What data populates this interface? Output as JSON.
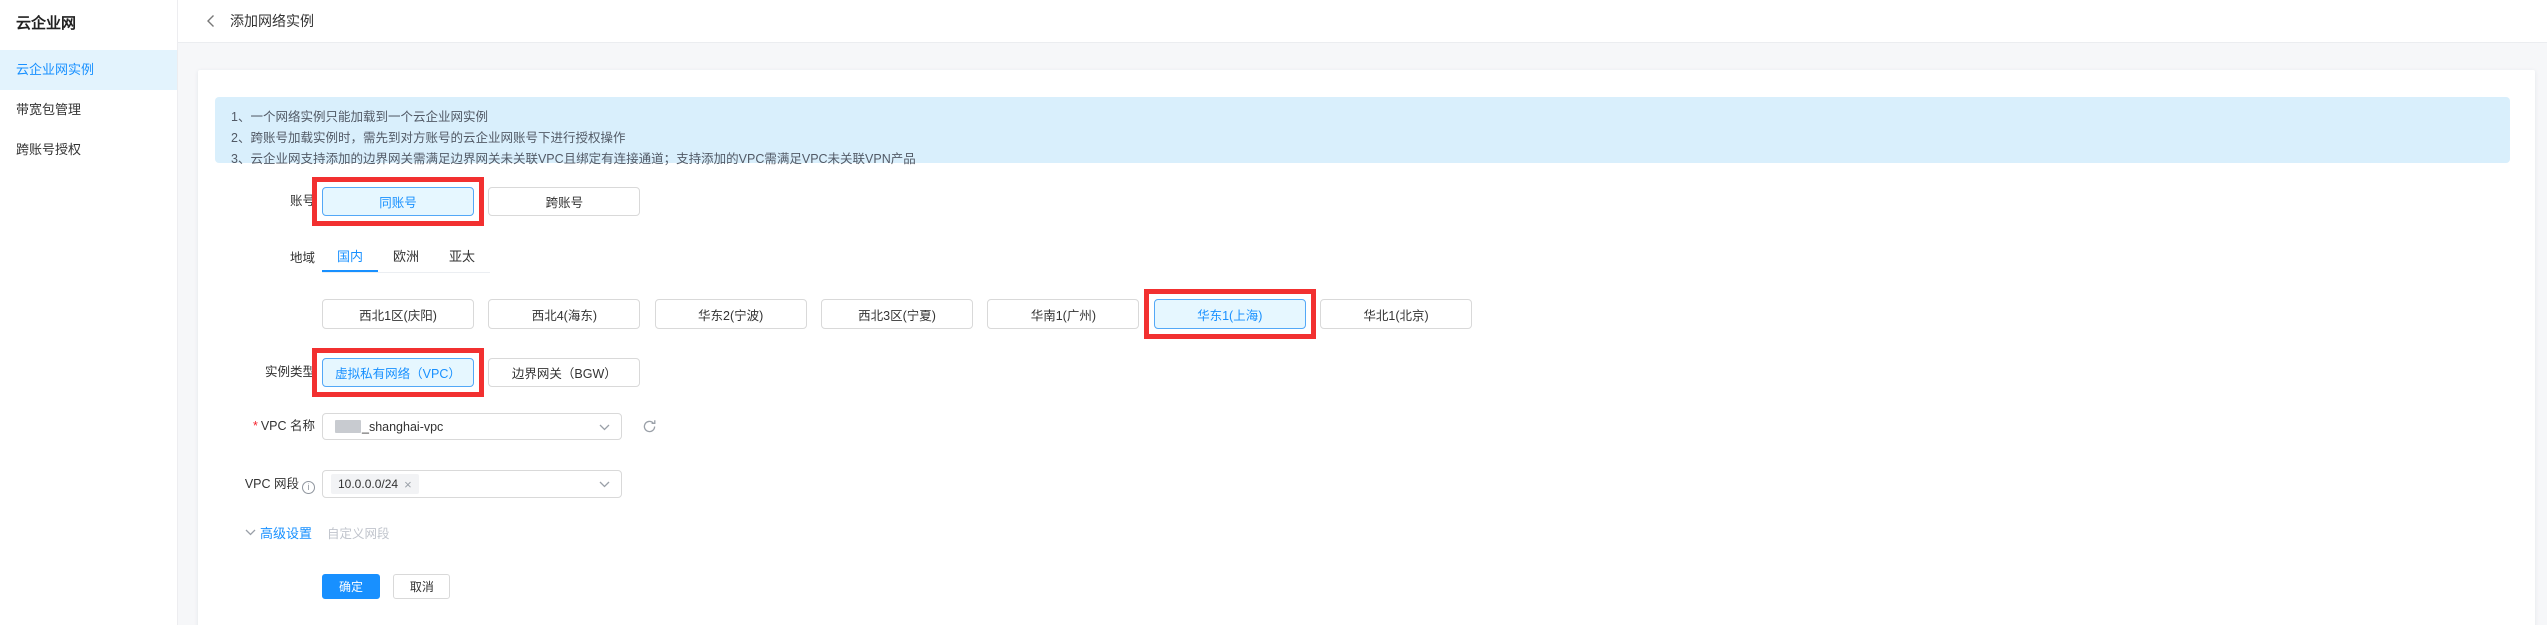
{
  "sidebar": {
    "title": "云企业网",
    "items": [
      {
        "label": "云企业网实例"
      },
      {
        "label": "带宽包管理"
      },
      {
        "label": "跨账号授权"
      }
    ]
  },
  "header": {
    "title": "添加网络实例"
  },
  "notice": {
    "line1": "1、一个网络实例只能加载到一个云企业网实例",
    "line2": "2、跨账号加载实例时，需先到对方账号的云企业网账号下进行授权操作",
    "line3": "3、云企业网支持添加的边界网关需满足边界网关未关联VPC且绑定有连接通道；支持添加的VPC需满足VPC未关联VPN产品"
  },
  "form": {
    "account": {
      "label": "账号",
      "same": "同账号",
      "cross": "跨账号"
    },
    "region": {
      "label": "地域",
      "tabs": [
        {
          "label": "国内"
        },
        {
          "label": "欧洲"
        },
        {
          "label": "亚太"
        }
      ],
      "regions": [
        {
          "label": "西北1区(庆阳)"
        },
        {
          "label": "西北4(海东)"
        },
        {
          "label": "华东2(宁波)"
        },
        {
          "label": "西北3区(宁夏)"
        },
        {
          "label": "华南1(广州)"
        },
        {
          "label": "华东1(上海)"
        },
        {
          "label": "华北1(北京)"
        }
      ]
    },
    "instance_type": {
      "label": "实例类型",
      "vpc": "虚拟私有网络（VPC）",
      "bgw": "边界网关（BGW）"
    },
    "vpc_name": {
      "label": "VPC 名称",
      "required_mark": "*",
      "value": "_shanghai-vpc"
    },
    "vpc_cidr": {
      "label": "VPC 网段",
      "tag": "10.0.0.0/24",
      "remove": "×"
    },
    "advanced": {
      "label": "高级设置",
      "hint": "自定义网段"
    },
    "actions": {
      "confirm": "确定",
      "cancel": "取消"
    }
  },
  "colors": {
    "accent": "#1890ff",
    "selected_bg": "#e6f7ff",
    "notice_bg": "#d9effc",
    "annotation_red": "#f23030",
    "sidebar_selected_bg": "#e3f3fd"
  }
}
